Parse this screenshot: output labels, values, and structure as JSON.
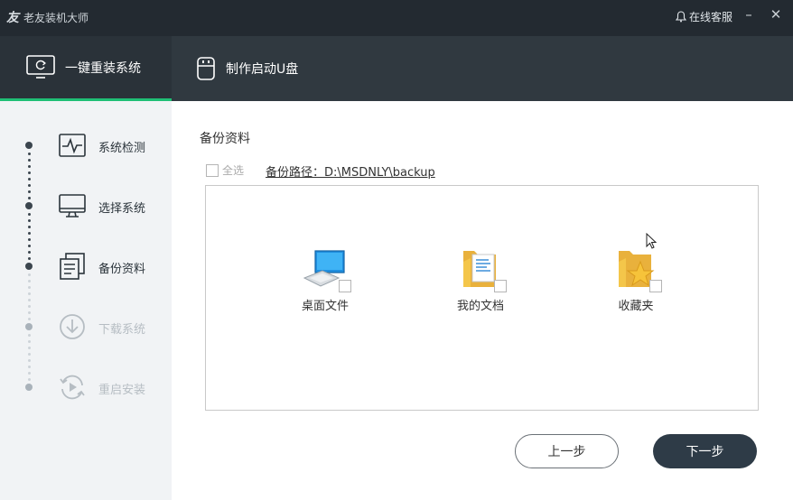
{
  "titlebar": {
    "logo_glyph": "友",
    "app_title": "老友装机大师",
    "service_label": "在线客服",
    "minimize_glyph": "–",
    "close_glyph": "✕"
  },
  "tabs": [
    {
      "label": "一键重装系统",
      "icon": "monitor-refresh-icon",
      "active": true
    },
    {
      "label": "制作启动U盘",
      "icon": "usb-drive-icon",
      "active": false
    }
  ],
  "steps": [
    {
      "label": "系统检测",
      "icon": "pulse-monitor-icon",
      "state": "done"
    },
    {
      "label": "选择系统",
      "icon": "monitor-icon",
      "state": "done"
    },
    {
      "label": "备份资料",
      "icon": "document-copy-icon",
      "state": "current"
    },
    {
      "label": "下载系统",
      "icon": "download-circle-icon",
      "state": "pending"
    },
    {
      "label": "重启安装",
      "icon": "restart-icon",
      "state": "pending"
    }
  ],
  "main": {
    "section_title": "备份资料",
    "select_all_label": "全选",
    "backup_path": "备份路径：D:\\MSDNLY\\backup",
    "items": [
      {
        "label": "桌面文件",
        "icon": "desktop-computer-icon",
        "checked": false
      },
      {
        "label": "我的文档",
        "icon": "documents-folder-icon",
        "checked": false
      },
      {
        "label": "收藏夹",
        "icon": "favorites-folder-icon",
        "checked": false
      }
    ]
  },
  "buttons": {
    "prev_label": "上一步",
    "next_label": "下一步"
  },
  "colors": {
    "titlebar_bg": "#232a31",
    "tabbar_bg": "#303940",
    "active_indicator": "#1fbf75",
    "sidebar_bg": "#f1f3f5",
    "next_button_bg": "#2e3b47",
    "folder_yellow": "#f4c64a"
  }
}
